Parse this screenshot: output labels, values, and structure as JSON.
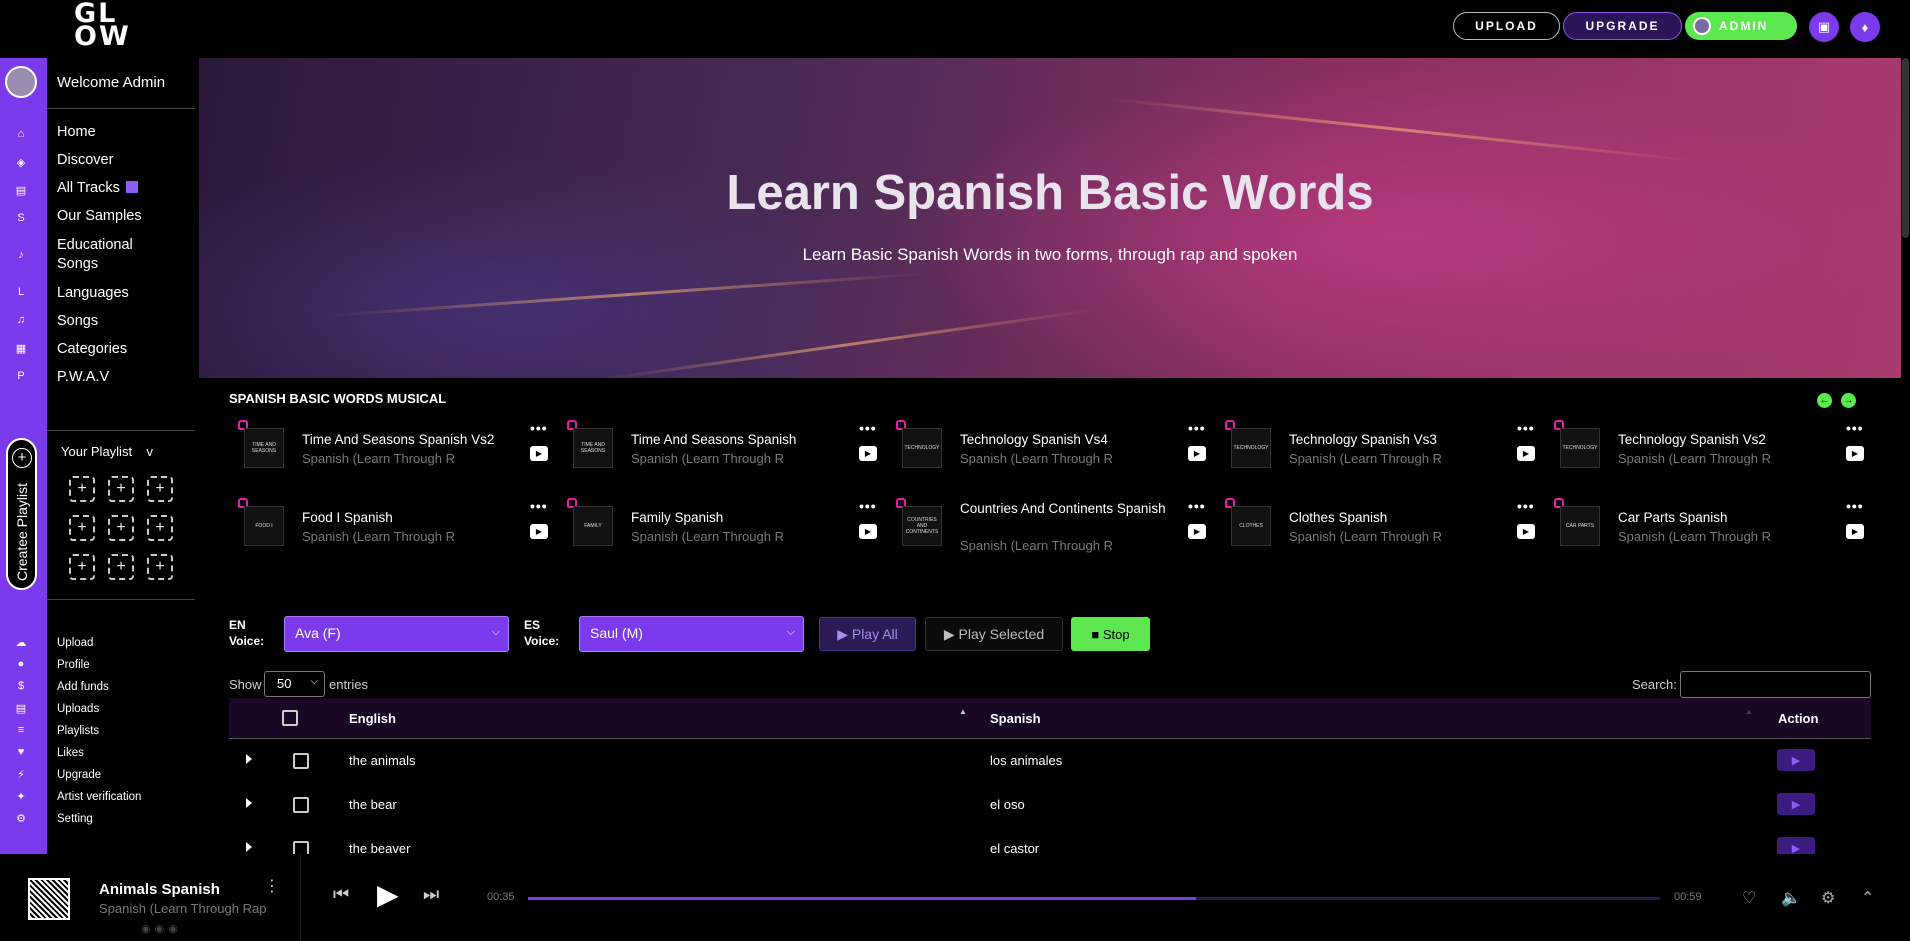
{
  "topbar": {
    "logo": "GL OW",
    "upload": "UPLOAD",
    "upgrade": "UPGRADE",
    "admin": "ADMIN"
  },
  "sidebar": {
    "welcome": "Welcome Admin",
    "nav": [
      "Home",
      "Discover",
      "All Tracks",
      "Our Samples",
      "Educational Songs",
      "Languages",
      "Songs",
      "Categories",
      "P.W.A.V"
    ],
    "playlist_title": "Your Playlist",
    "playlist_chevron": "v",
    "create_playlist": "Createe Playlist",
    "account": [
      "Upload",
      "Profile",
      "Add funds",
      "Uploads",
      "Playlists",
      "Likes",
      "Upgrade",
      "Artist verification",
      "Setting"
    ]
  },
  "hero": {
    "title": "Learn Spanish Basic Words",
    "subtitle": "Learn Basic Spanish Words in two forms, through rap and spoken"
  },
  "section": {
    "title": "SPANISH BASIC WORDS MUSICAL",
    "tracks": [
      {
        "title": "Time And Seasons Spanish Vs2",
        "artist": "Spanish (Learn Through R",
        "thumb": "TIME AND SEASONS"
      },
      {
        "title": "Time And Seasons Spanish",
        "artist": "Spanish (Learn Through R",
        "thumb": "TIME AND SEASONS"
      },
      {
        "title": "Technology Spanish Vs4",
        "artist": "Spanish (Learn Through R",
        "thumb": "TECHNOLOGY"
      },
      {
        "title": "Technology Spanish Vs3",
        "artist": "Spanish (Learn Through R",
        "thumb": "TECHNOLOGY"
      },
      {
        "title": "Technology Spanish Vs2",
        "artist": "Spanish (Learn Through R",
        "thumb": "TECHNOLOGY"
      },
      {
        "title": "Food I Spanish",
        "artist": "Spanish (Learn Through R",
        "thumb": "FOOD I"
      },
      {
        "title": "Family Spanish",
        "artist": "Spanish (Learn Through R",
        "thumb": "FAMILY"
      },
      {
        "title": "Countries And Continents Spanish",
        "artist": "Spanish (Learn Through R",
        "thumb": "COUNTRIES AND CONTINENTS"
      },
      {
        "title": "Clothes Spanish",
        "artist": "Spanish (Learn Through R",
        "thumb": "CLOTHES"
      },
      {
        "title": "Car Parts Spanish",
        "artist": "Spanish (Learn Through R",
        "thumb": "CAR PARTS"
      }
    ]
  },
  "controls": {
    "en_label": "EN Voice:",
    "en_voice": "Ava (F)",
    "es_label": "ES Voice:",
    "es_voice": "Saul (M)",
    "play_all": "▶ Play All",
    "play_selected": "▶ Play Selected",
    "stop": "■ Stop"
  },
  "table": {
    "show_label": "Show",
    "show_value": "50",
    "entries_label": "entries",
    "search_label": "Search:",
    "headers": {
      "english": "English",
      "spanish": "Spanish",
      "action": "Action"
    },
    "rows": [
      {
        "english": "the animals",
        "spanish": "los animales"
      },
      {
        "english": "the bear",
        "spanish": "el oso"
      },
      {
        "english": "the beaver",
        "spanish": "el castor"
      }
    ]
  },
  "player": {
    "title": "Animals Spanish",
    "artist": "Spanish (Learn Through Rap",
    "thumb": "ANIMALS",
    "current_time": "00:35",
    "duration": "00:59",
    "progress": 0.59
  },
  "colors": {
    "accent": "#7c3aed",
    "green": "#5ce84e",
    "lock": "#e01faf"
  }
}
